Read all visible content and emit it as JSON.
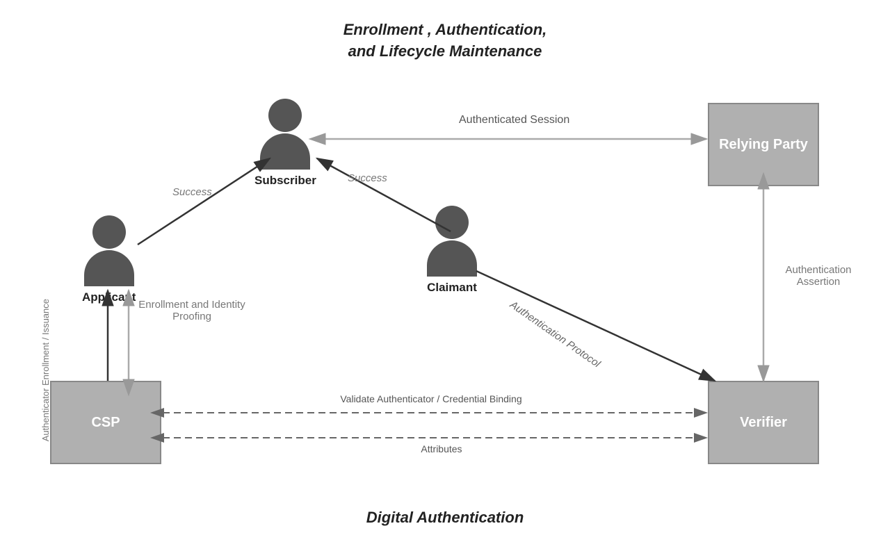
{
  "title_top_line1": "Enrollment ,  Authentication,",
  "title_top_line2": "and Lifecycle Maintenance",
  "title_bottom": "Digital Authentication",
  "boxes": {
    "csp": "CSP",
    "verifier": "Verifier",
    "relying_party": "Relying Party"
  },
  "persons": {
    "applicant": "Applicant",
    "subscriber": "Subscriber",
    "claimant": "Claimant"
  },
  "arrow_labels": {
    "success_left": "Success",
    "success_right": "Success",
    "authenticated_session": "Authenticated Session",
    "enrollment_identity_proofing": "Enrollment and\nIdentity Proofing",
    "authenticator_enrollment_issuance": "Authenticator\nEnrollment /\nIssuance",
    "authentication_protocol": "Authentication Protocol",
    "authentication_assertion": "Authentication\nAssertion",
    "validate_authenticator": "Validate Authenticator / Credential Binding",
    "attributes": "Attributes"
  },
  "colors": {
    "box_bg": "#b0b0b0",
    "person_fill": "#555555",
    "arrow_dark": "#333333",
    "arrow_light": "#999999",
    "text_dark": "#222222",
    "text_mid": "#666666"
  }
}
